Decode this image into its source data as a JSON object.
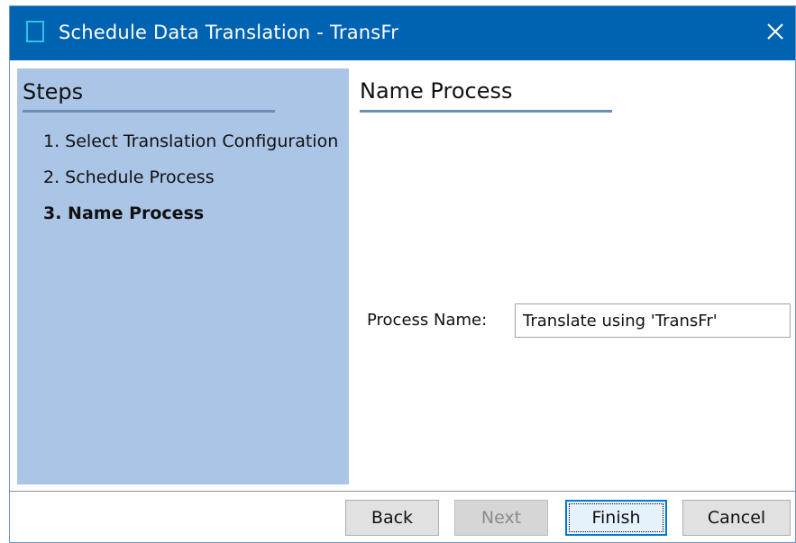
{
  "window": {
    "title": "Schedule Data Translation - TransFr"
  },
  "steps": {
    "heading": "Steps",
    "items": [
      "1. Select Translation Configuration",
      "2. Schedule Process",
      "3. Name Process"
    ],
    "current_index": 2
  },
  "content": {
    "heading": "Name Process",
    "process_name_label": "Process Name:",
    "process_name_value": "Translate using 'TransFr'"
  },
  "buttons": {
    "back": "Back",
    "next": "Next",
    "finish": "Finish",
    "cancel": "Cancel"
  },
  "colors": {
    "titlebar": "#0063b1",
    "steps_panel": "#abc5e6",
    "rule": "#6d8fb5"
  },
  "icons": {
    "app": "window-app-icon",
    "close": "close-icon"
  }
}
